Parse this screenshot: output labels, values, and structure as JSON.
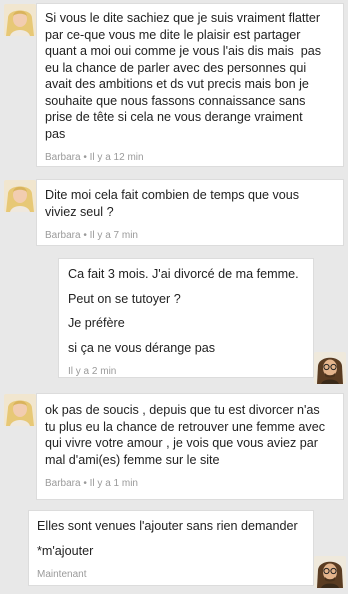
{
  "messages": [
    {
      "side": "left",
      "lines": [
        "Si vous le dite sachiez que je suis vraiment flatter",
        "par ce-que vous me dite le plaisir est partager",
        "quant a moi oui comme je vous l'ais dis mais  pas",
        "eu la chance de parler avec des personnes qui",
        "avait des ambitions et ds vut precis mais bon je",
        "souhaite que nous fassons connaissance sans",
        "prise de tête si cela ne vous derange vraiment",
        "pas"
      ],
      "author": "Barbara",
      "time": "Il y a 12 min"
    },
    {
      "side": "left",
      "lines": [
        "Dite moi cela fait combien de temps que vous",
        "viviez seul ?"
      ],
      "author": "Barbara",
      "time": "Il y a 7 min"
    },
    {
      "side": "right",
      "lines": [
        "Ca fait 3 mois. J'ai divorcé de ma femme.",
        "Peut on se tutoyer ?",
        "Je préfère",
        "si ça ne vous dérange pas"
      ],
      "author": "",
      "time": "Il y a 2 min"
    },
    {
      "side": "left",
      "lines": [
        "ok pas de soucis , depuis que tu est divorcer n'as",
        "tu plus eu la chance de retrouver une femme avec",
        "qui vivre votre amour , je vois que vous aviez par",
        "mal d'ami(es) femme sur le site"
      ],
      "author": "Barbara",
      "time": "Il y a 1 min"
    },
    {
      "side": "right",
      "lines": [
        "Elles sont venues l'ajouter sans rien demander",
        "*m'ajouter"
      ],
      "author": "",
      "time": "Maintenant"
    }
  ],
  "meta_separator": " • ",
  "colors": {
    "background": "#e8e8e8",
    "bubble": "#ffffff",
    "text": "#222222",
    "meta": "#9a9a9a"
  }
}
